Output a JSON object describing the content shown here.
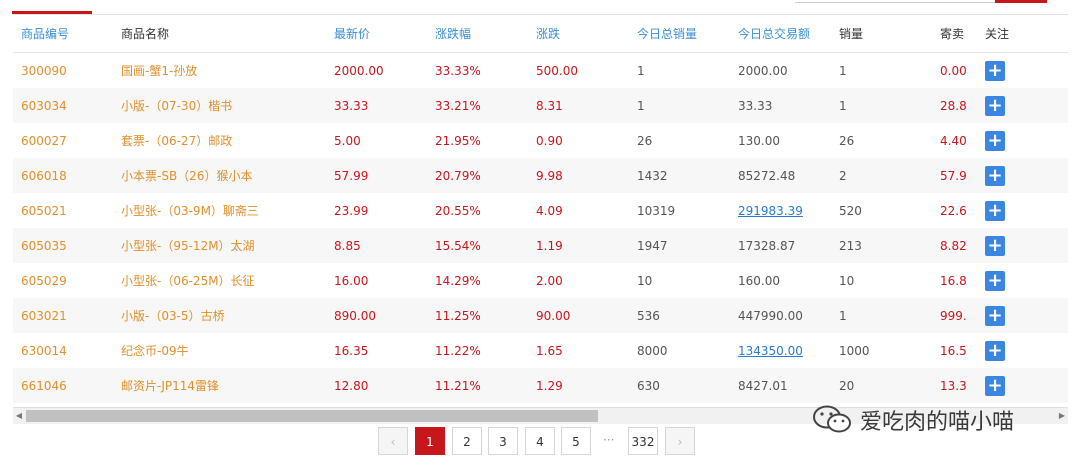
{
  "headers": [
    "商品编号",
    "商品名称",
    "最新价",
    "涨跌幅",
    "涨跌",
    "今日总销量",
    "今日总交易额",
    "销量",
    "寄卖",
    "关注"
  ],
  "rows": [
    {
      "code": "300090",
      "name": "国画-蟹1-孙放",
      "price": "2000.00",
      "pct": "33.33%",
      "chg": "500.00",
      "vol": "1",
      "amt": "2000.00",
      "amt_link": false,
      "sales": "1",
      "consign": "0.00"
    },
    {
      "code": "603034",
      "name": "小版-（07-30）楷书",
      "price": "33.33",
      "pct": "33.21%",
      "chg": "8.31",
      "vol": "1",
      "amt": "33.33",
      "amt_link": false,
      "sales": "1",
      "consign": "28.8"
    },
    {
      "code": "600027",
      "name": "套票-（06-27）邮政",
      "price": "5.00",
      "pct": "21.95%",
      "chg": "0.90",
      "vol": "26",
      "amt": "130.00",
      "amt_link": false,
      "sales": "26",
      "consign": "4.40"
    },
    {
      "code": "606018",
      "name": "小本票-SB（26）猴小本",
      "price": "57.99",
      "pct": "20.79%",
      "chg": "9.98",
      "vol": "1432",
      "amt": "85272.48",
      "amt_link": false,
      "sales": "2",
      "consign": "57.9"
    },
    {
      "code": "605021",
      "name": "小型张-（03-9M）聊斋三",
      "price": "23.99",
      "pct": "20.55%",
      "chg": "4.09",
      "vol": "10319",
      "amt": "291983.39",
      "amt_link": true,
      "sales": "520",
      "consign": "22.6"
    },
    {
      "code": "605035",
      "name": "小型张-（95-12M）太湖",
      "price": "8.85",
      "pct": "15.54%",
      "chg": "1.19",
      "vol": "1947",
      "amt": "17328.87",
      "amt_link": false,
      "sales": "213",
      "consign": "8.82"
    },
    {
      "code": "605029",
      "name": "小型张-（06-25M）长征",
      "price": "16.00",
      "pct": "14.29%",
      "chg": "2.00",
      "vol": "10",
      "amt": "160.00",
      "amt_link": false,
      "sales": "10",
      "consign": "16.8"
    },
    {
      "code": "603021",
      "name": "小版-（03-5）古桥",
      "price": "890.00",
      "pct": "11.25%",
      "chg": "90.00",
      "vol": "536",
      "amt": "447990.00",
      "amt_link": false,
      "sales": "1",
      "consign": "999."
    },
    {
      "code": "630014",
      "name": "纪念币-09牛",
      "price": "16.35",
      "pct": "11.22%",
      "chg": "1.65",
      "vol": "8000",
      "amt": "134350.00",
      "amt_link": true,
      "sales": "1000",
      "consign": "16.5"
    },
    {
      "code": "661046",
      "name": "邮资片-JP114雷锋",
      "price": "12.80",
      "pct": "11.21%",
      "chg": "1.29",
      "vol": "630",
      "amt": "8427.01",
      "amt_link": false,
      "sales": "20",
      "consign": "13.3"
    }
  ],
  "follow_icon": "plus-icon",
  "pagination": {
    "prev": "‹",
    "pages": [
      "1",
      "2",
      "3",
      "4",
      "5"
    ],
    "ellipsis": "···",
    "last": "332",
    "next": "›",
    "current": "1"
  },
  "watermark": "爱吃肉的喵小喵",
  "colors": {
    "accent": "#c8161d",
    "link": "#3a8fd6",
    "code": "#e0902c",
    "plus": "#3a86e0"
  }
}
